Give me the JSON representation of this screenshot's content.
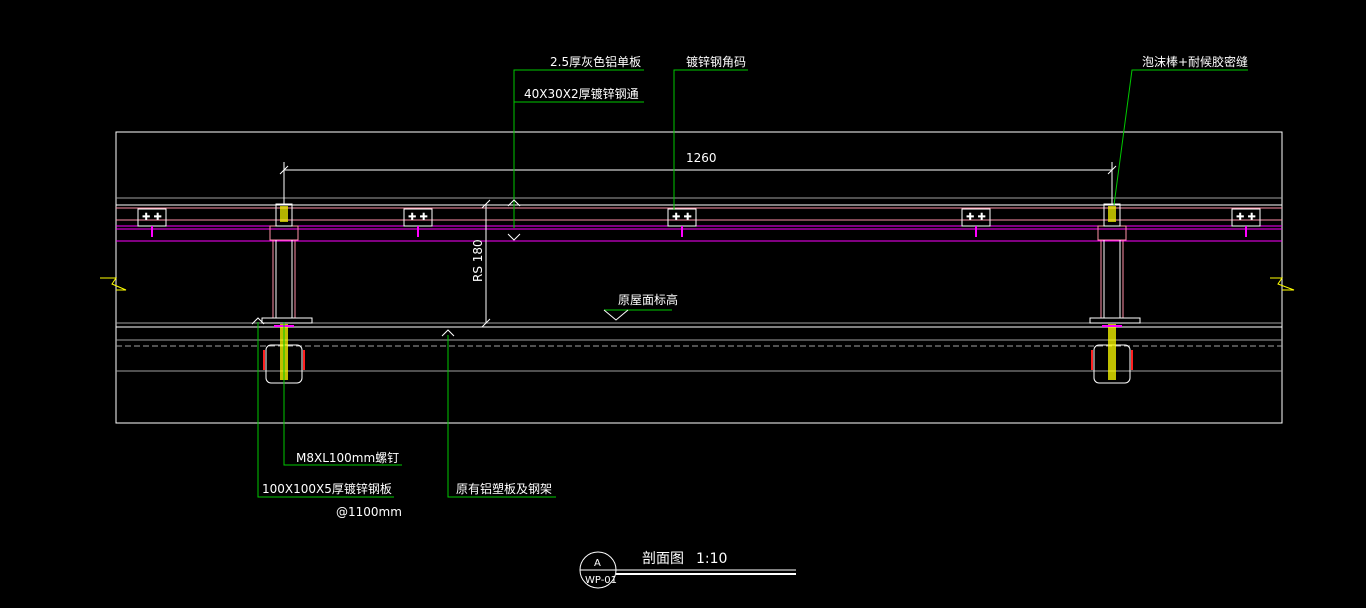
{
  "labels": {
    "aluminum_panel": "2.5厚灰色铝单板",
    "steel_purlin": "40X30X2厚镀锌钢通",
    "corner_code": "镀锌钢角码",
    "sealant": "泡沫棒+耐候胶密缝",
    "span_dim": "1260",
    "height_dim": "RS 180",
    "roof_level": "原屋面标高",
    "bolt": "M8XL100mm螺钉",
    "base_plate": "100X100X5厚镀锌钢板",
    "spacing": "@1100mm",
    "existing_roof": "原有铝塑板及钢架"
  },
  "title_block": {
    "symbol_top": "A",
    "symbol_bottom": "WP-01",
    "title": "剖面图",
    "scale": "1:10"
  },
  "colors": {
    "background": "#000000",
    "leader": "#00c800",
    "outline": "#ffffff",
    "member": "#ff8fa8",
    "magenta": "#ff00ff",
    "bolt_yellow": "#ffff00",
    "anchor_red": "#ff2020",
    "blue": "#3030ff",
    "gray": "#a0a0a0"
  }
}
